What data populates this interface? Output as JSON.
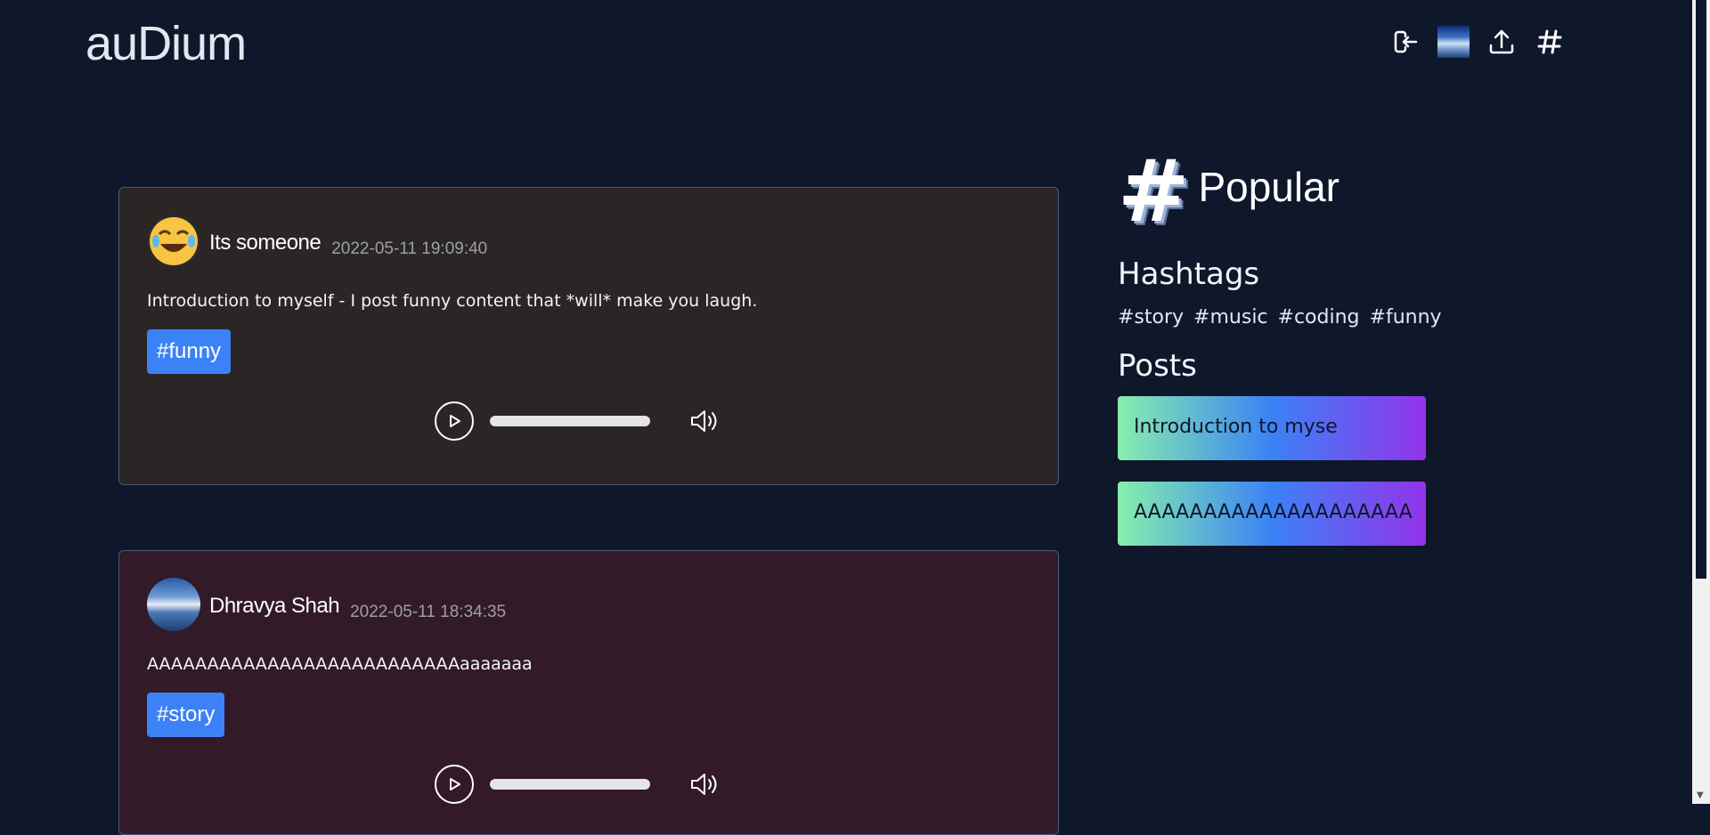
{
  "app": {
    "logo": "auDium"
  },
  "nav": [
    {
      "name": "logout-icon"
    },
    {
      "name": "profile-avatar"
    },
    {
      "name": "upload-icon"
    },
    {
      "name": "hashtag-icon"
    }
  ],
  "posts": [
    {
      "author": "Its someone",
      "timestamp": "2022-05-11 19:09:40",
      "text": "Introduction to myself - I post funny content that *will* make you laugh.",
      "tag": "#funny",
      "avatar_icon": "crying-laughing-emoji-icon"
    },
    {
      "author": "Dhravya Shah",
      "timestamp": "2022-05-11 18:34:35",
      "text": "AAAAAAAAAAAAAAAAAAAAAAAAAAaaaaaaa",
      "tag": "#story",
      "avatar_icon": "lake-landscape-avatar"
    }
  ],
  "sidebar": {
    "title": "Popular",
    "hashtags_title": "Hashtags",
    "hashtags": [
      "#story",
      "#music",
      "#coding",
      "#funny"
    ],
    "posts_title": "Posts",
    "popular_posts": [
      "Introduction to myse",
      "AAAAAAAAAAAAAAAAAAAA"
    ]
  },
  "colors": {
    "background": "#0f172a",
    "tag": "#3b82f6",
    "card1": "#2b2625",
    "card2": "#331a28"
  }
}
